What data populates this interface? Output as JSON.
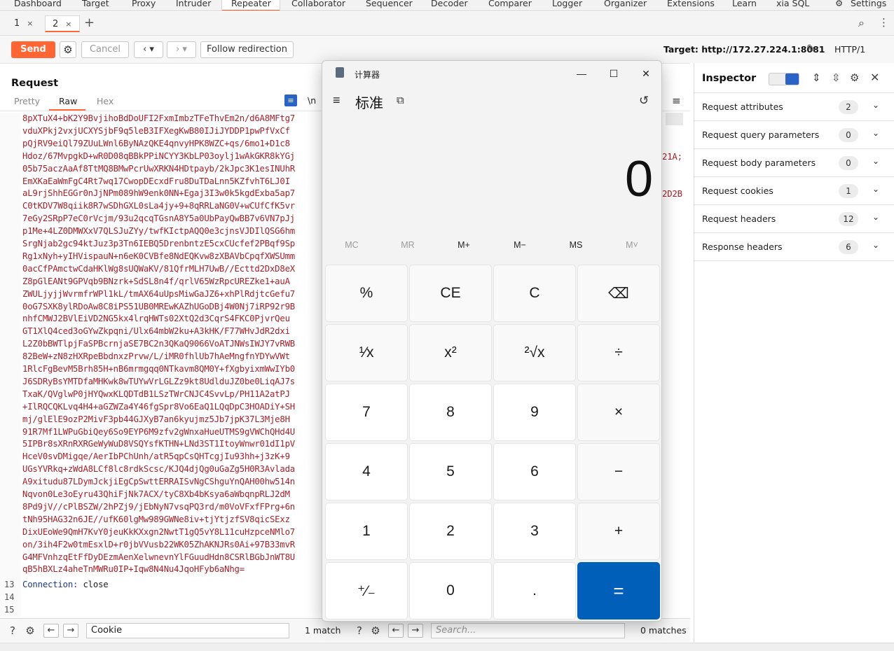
{
  "nav": {
    "items": [
      "Dashboard",
      "Target",
      "Proxy",
      "Intruder",
      "Repeater",
      "Collaborator",
      "Sequencer",
      "Decoder",
      "Comparer",
      "Logger",
      "Organizer",
      "Extensions",
      "Learn",
      "xia SQL"
    ],
    "settings_label": "Settings",
    "active": "Repeater",
    "accent_color": "#ff6633"
  },
  "repeater_tabs": [
    {
      "label": "1",
      "close": "×"
    },
    {
      "label": "2",
      "close": "×"
    }
  ],
  "toolbar": {
    "send_label": "Send",
    "cancel_label": "Cancel",
    "follow_label": "Follow redirection",
    "target_label": "Target: http://172.27.224.1:8081",
    "protocol_label": "HTTP/1"
  },
  "request": {
    "title": "Request",
    "tabs": [
      "Pretty",
      "Raw",
      "Hex"
    ],
    "active_tab": "Raw",
    "newline_toggle": "\\n",
    "code_lines": [
      "8pXTuX4+bK2Y9BvjihoBdDoUFI2FxmImbzTFeThvEm2n/d6A8MFtg7",
      "vduXPkj2vxjUCXYSjbF9q5leB3IFXegKwB80IJiJYDDP1pwPfVxCf",
      "pQjRV9eiQl79ZUuLWnl6ByNAzQKE4qnvyHPK8WZC+qs/6mo1+D1c8",
      "Hdoz/67MvpgkD+wR0D08qBBkPPiNCYY3KbLP03oylj1wAkGKR8kYGj",
      "05b75aczAaAf8TtMQ8BMwPcrUwXRKN4HDtpayb/2kJpc3K1esINUhR",
      "EmXKaEaWmFgC4Rt7wq17CwopDEcxdFru8DuTDaLnn5KZfvhT6LJ0I",
      "aL9rjShhEGGr0nJjNPm089hW9enk0NN+Egaj3I3w0k5kgdExba5ap7",
      "C0tKDV7W8qiik8R7wSDhGXL0sLa4jy+9+8qRRLaNG0V+wCUfCfK5vr",
      "7eGy2SRpP7eC0rVcjm/93u2qcqTGsnA8Y5a0UbPayQwBB7v6VN7pJj",
      "p1Me+4LZ0DMWXxV7QLSJuZYy/twfKIctpAQQ0e3cjnsVJDIlQSG6hm",
      "SrgNjab2gc94ktJuz3p3Tn6IEBQ5DrenbntzE5cxCUcfef2PBqf9Sp",
      "Rg1xNyh+yIHVispauN+n6eK0CVBfe8NdEQKvw8zXBAVbCpqfXWSUmm",
      "0acCfPAmctwCdaHKlWg8sUQWaKV/81QfrMLH7UwB//Ecttd2DxD8eX",
      "Z8pGlEANt9GPVqb9BNzrk+SdSL8n4f/qrlV65WzRpcUREZke1+auA",
      "ZWULjyjjWvrmfrWPl1kL/tmAX64uUpsMiwGaJZ6+xhPlRdjtcGefu7",
      "0oG7SXK8ylRDoAw8C8iPS51UB0MREwKAZhUGoDBj4W0Nj7iRP92r9B",
      "nhfCMWJ2BVlEiVD2NG5kx4lrqHWTs02XtQ2d3CqrS4FKC0PjvrQeu",
      "GT1XlQ4ced3oGYwZkpqni/Ulx64mbW2ku+A3kHK/F77WHvJdR2dxi",
      "L2Z0bBWTlpjFaSPBcrnjaSE7BC2n3QKaQ9066VoATJNWsIWJY7vRWB",
      "82BeW+zN8zHXRpeBbdnxzPrvw/L/iMR0fhlUb7hAeMngfnYDYwVWt",
      "1RlcFgBevM5Brh85H+nB6mrmgqq0NTkavm8QM0Y+fXgbyixmWwIYb0",
      "J6SDRyBsYMTDfaMHKwk8wTUYwVrLGLZz9kt8UdlduJZ0be0LiqAJ7s",
      "TxaK/QVglwP0jHYQwxKLQDTdB1LSzTWrCNJC4SvvLp/PH11A2atPJ",
      "+IlRQCQKLvq4H4+aGZWZa4Y46fgSpr8Vo6EaQ1LQqDpC3HOADiY+SH",
      "mj/glElE9ozP2MivF3pb44GJXyB7an6kyujmz5Jb7jpK37L3Mje8H",
      "91R7Mf1LWPuGbiQey6So9EYP6M9zfv2gWnxaHueUTMS9gVWChQHd4U",
      "5IPBr8sXRnRXRGeWyWuD8VSQYsfKTHN+LNd3ST1ItoyWnwr01dI1pV",
      "HceV0svDMigqe/AerIbPChUnh/atR5qpCsQHTcgjIu93hh+j3zK+9",
      "UGsYVRkq+zWdA8LCf8lc8rdkScsc/KJQ4djQg0uGaZg5H0R3Avlada",
      "A9xitudu87LDymJckjiEgCpSwttERRAISvNgCShguYnQAH00hw514n",
      "Nqvon0Le3oEyru43QhiFjNk7ACX/tyC8Xb4bKsya6aWbqnpRLJ2dM",
      "8Pd9jV//cPlBSZW/2hPZj9/jEbNyN7vsqPQ3rd/m0VoVFxfFPrg+6n",
      "tNh95HAG32n6JE//ufK60lgMw989GWNe8iv+tjYtjzfSV8qicSExz",
      "DixUEoWe9QmH7KvY0jeuKkKXxgn2NwtT1gQ5vY8L11cuHzpceNMlo7",
      "on/3ih4F2w0tmEsxlD+r0jbVVusb22WK05ZhAKNJRs0Ai+97B33mvR",
      "G4MFVnhzqEtFfDyDEzmAenXelwnevnYlFGuudHdn8CSRlBGbJnWT8U",
      "qB5hBXLz4aheTnMWRu0IP+Iqw8N4Nu4JqoHFyb6aNhg="
    ],
    "right_fragment_1": "21A;",
    "right_fragment_2": "2D2B",
    "header_line": {
      "num": "13",
      "name": "Connection:",
      "value": " close"
    },
    "empty_lines": [
      "14",
      "15"
    ]
  },
  "search_left": {
    "value": "Cookie",
    "result": "1 match"
  },
  "search_right": {
    "placeholder": "Search...",
    "result": "0 matches"
  },
  "inspector": {
    "title": "Inspector",
    "rows": [
      {
        "label": "Request attributes",
        "count": "2"
      },
      {
        "label": "Request query parameters",
        "count": "0"
      },
      {
        "label": "Request body parameters",
        "count": "0"
      },
      {
        "label": "Request cookies",
        "count": "1"
      },
      {
        "label": "Request headers",
        "count": "12"
      },
      {
        "label": "Response headers",
        "count": "6"
      }
    ]
  },
  "calculator": {
    "window_title": "计算器",
    "mode": "标准",
    "display": "0",
    "memory": [
      "MC",
      "MR",
      "M+",
      "M−",
      "MS",
      "M˅"
    ],
    "keys": [
      [
        "%",
        "CE",
        "C",
        "⌫"
      ],
      [
        "¹⁄x",
        "x²",
        "²√x",
        "÷"
      ],
      [
        "7",
        "8",
        "9",
        "×"
      ],
      [
        "4",
        "5",
        "6",
        "−"
      ],
      [
        "1",
        "2",
        "3",
        "+"
      ],
      [
        "⁺⁄₋",
        "0",
        ".",
        "="
      ]
    ],
    "equals_color": "#005fb8"
  }
}
